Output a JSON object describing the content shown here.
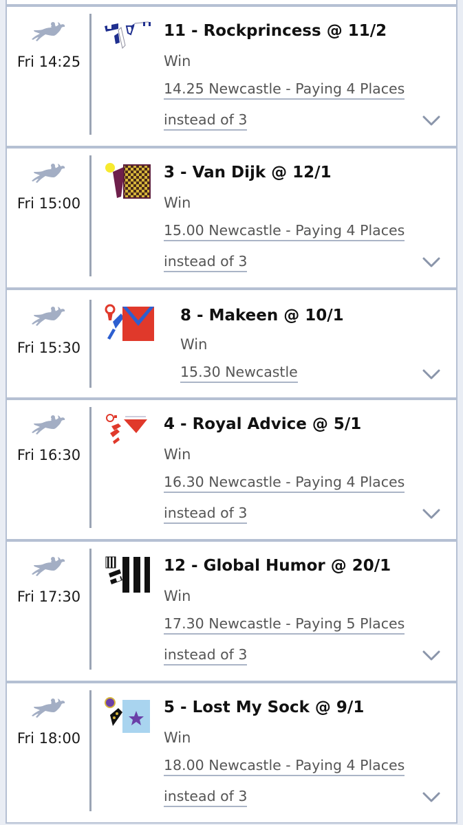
{
  "bets": [
    {
      "time": "Fri 14:25",
      "selection": "11 - Rockprincess @ 11/2",
      "market": "Win",
      "event_line1": "14.25 Newcastle - Paying 4 Places",
      "event_line2": "instead of 3",
      "silk": "navy-white-jockey-silks"
    },
    {
      "time": "Fri 15:00",
      "selection": "3 - Van Dijk @ 12/1",
      "market": "Win",
      "event_line1": "15.00 Newcastle - Paying 4 Places",
      "event_line2": "instead of 3",
      "silk": "maroon-yellow-check-silks"
    },
    {
      "time": "Fri 15:30",
      "selection": "8 - Makeen @ 10/1",
      "market": "Win",
      "event_line1": "15.30 Newcastle",
      "event_line2": "",
      "silk": "red-blue-chevron-silks"
    },
    {
      "time": "Fri 16:30",
      "selection": "4 - Royal Advice @ 5/1",
      "market": "Win",
      "event_line1": "16.30 Newcastle - Paying 4 Places",
      "event_line2": "instead of 3",
      "silk": "white-red-triangle-silks"
    },
    {
      "time": "Fri 17:30",
      "selection": "12 - Global Humor @ 20/1",
      "market": "Win",
      "event_line1": "17.30 Newcastle - Paying 5 Places",
      "event_line2": "instead of 3",
      "silk": "black-white-stripe-silks"
    },
    {
      "time": "Fri 18:00",
      "selection": "5 - Lost My Sock @ 9/1",
      "market": "Win",
      "event_line1": "18.00 Newcastle - Paying 4 Places",
      "event_line2": "instead of 3",
      "silk": "lightblue-purple-star-silks"
    }
  ],
  "icons": {
    "horse": "horse-racing-icon",
    "expand": "chevron-down-icon"
  },
  "colors": {
    "horse_icon": "#a3aec4",
    "divider": "#9ba4b4",
    "card_border": "#b5c0d3",
    "chevron": "#8a95aa"
  }
}
